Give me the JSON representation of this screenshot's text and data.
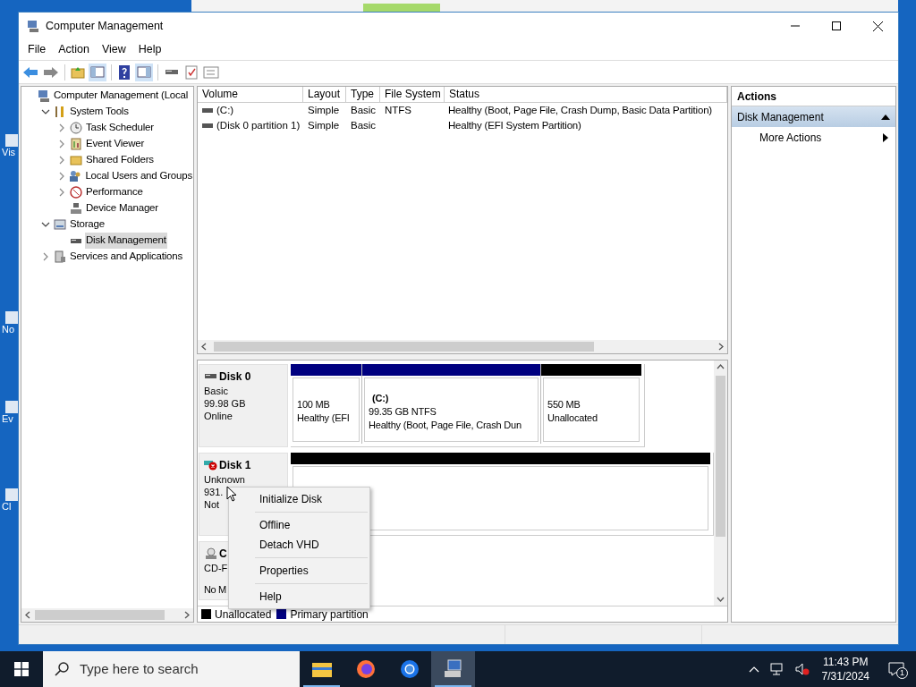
{
  "desktop_icons": [
    {
      "label": "Vis"
    },
    {
      "label": "No"
    },
    {
      "label": "Ev"
    },
    {
      "label": "Cl"
    }
  ],
  "window": {
    "title": "Computer Management"
  },
  "menu": [
    "File",
    "Action",
    "View",
    "Help"
  ],
  "tree": [
    {
      "label": "Computer Management (Local",
      "selected": false,
      "children": [
        {
          "label": "System Tools",
          "expanded": true,
          "selected": false,
          "children": [
            {
              "label": "Task Scheduler",
              "expanded": false,
              "selected": false
            },
            {
              "label": "Event Viewer",
              "expanded": false,
              "selected": false
            },
            {
              "label": "Shared Folders",
              "expanded": false,
              "selected": false
            },
            {
              "label": "Local Users and Groups",
              "expanded": false,
              "selected": false
            },
            {
              "label": "Performance",
              "expanded": false,
              "selected": false
            },
            {
              "label": "Device Manager",
              "selected": false
            }
          ]
        },
        {
          "label": "Storage",
          "expanded": true,
          "selected": false,
          "children": [
            {
              "label": "Disk Management",
              "selected": true
            }
          ]
        },
        {
          "label": "Services and Applications",
          "expanded": false,
          "selected": false
        }
      ]
    }
  ],
  "table": {
    "columns": [
      "Volume",
      "Layout",
      "Type",
      "File System",
      "Status"
    ],
    "rows": [
      {
        "volume": "(C:)",
        "layout": "Simple",
        "type": "Basic",
        "file_system": "NTFS",
        "status": "Healthy (Boot, Page File, Crash Dump, Basic Data Partition)"
      },
      {
        "volume": "(Disk 0 partition 1)",
        "layout": "Simple",
        "type": "Basic",
        "status": "Healthy (EFI System Partition)"
      }
    ]
  },
  "disks": [
    {
      "name": "Disk 0",
      "kind": "basic",
      "lines": [
        "Basic",
        "99.98 GB",
        "Online"
      ],
      "partitions": [
        {
          "kind": "primary",
          "lines": [
            "100 MB",
            "Healthy (EFI"
          ]
        },
        {
          "kind": "primary",
          "title": "(C:)",
          "lines": [
            "99.35 GB NTFS",
            "Healthy (Boot, Page File, Crash Dun"
          ]
        },
        {
          "kind": "unallocated",
          "lines": [
            "550 MB",
            "Unallocated"
          ]
        }
      ]
    },
    {
      "name": "Disk 1",
      "kind": "unknown",
      "lines": [
        "Unknown",
        "931.",
        "Not"
      ],
      "partitions": [
        {
          "kind": "unallocated"
        }
      ]
    },
    {
      "name": "C",
      "kind": "cdrom",
      "lines": [
        "CD-F"
      ],
      "bottom": "No M"
    }
  ],
  "legend": [
    {
      "label": "Unallocated",
      "color": "#000000"
    },
    {
      "label": "Primary partition",
      "color": "#000080"
    }
  ],
  "actions": {
    "title": "Actions",
    "sections": [
      {
        "label": "Disk Management",
        "expanded": true,
        "items": [
          "More Actions"
        ]
      }
    ]
  },
  "context_menu": [
    [
      "Initialize Disk"
    ],
    [
      "Offline",
      "Detach VHD"
    ],
    [
      "Properties"
    ],
    [
      "Help"
    ]
  ],
  "taskbar": {
    "search": {
      "placeholder": "Type here to search"
    },
    "apps": [
      {
        "running": true,
        "selected": false
      },
      {
        "running": false,
        "selected": false
      },
      {
        "running": false,
        "selected": false
      },
      {
        "running": true,
        "selected": true
      }
    ],
    "time": "11:43 PM",
    "date": "7/31/2024",
    "notifications": "1"
  }
}
